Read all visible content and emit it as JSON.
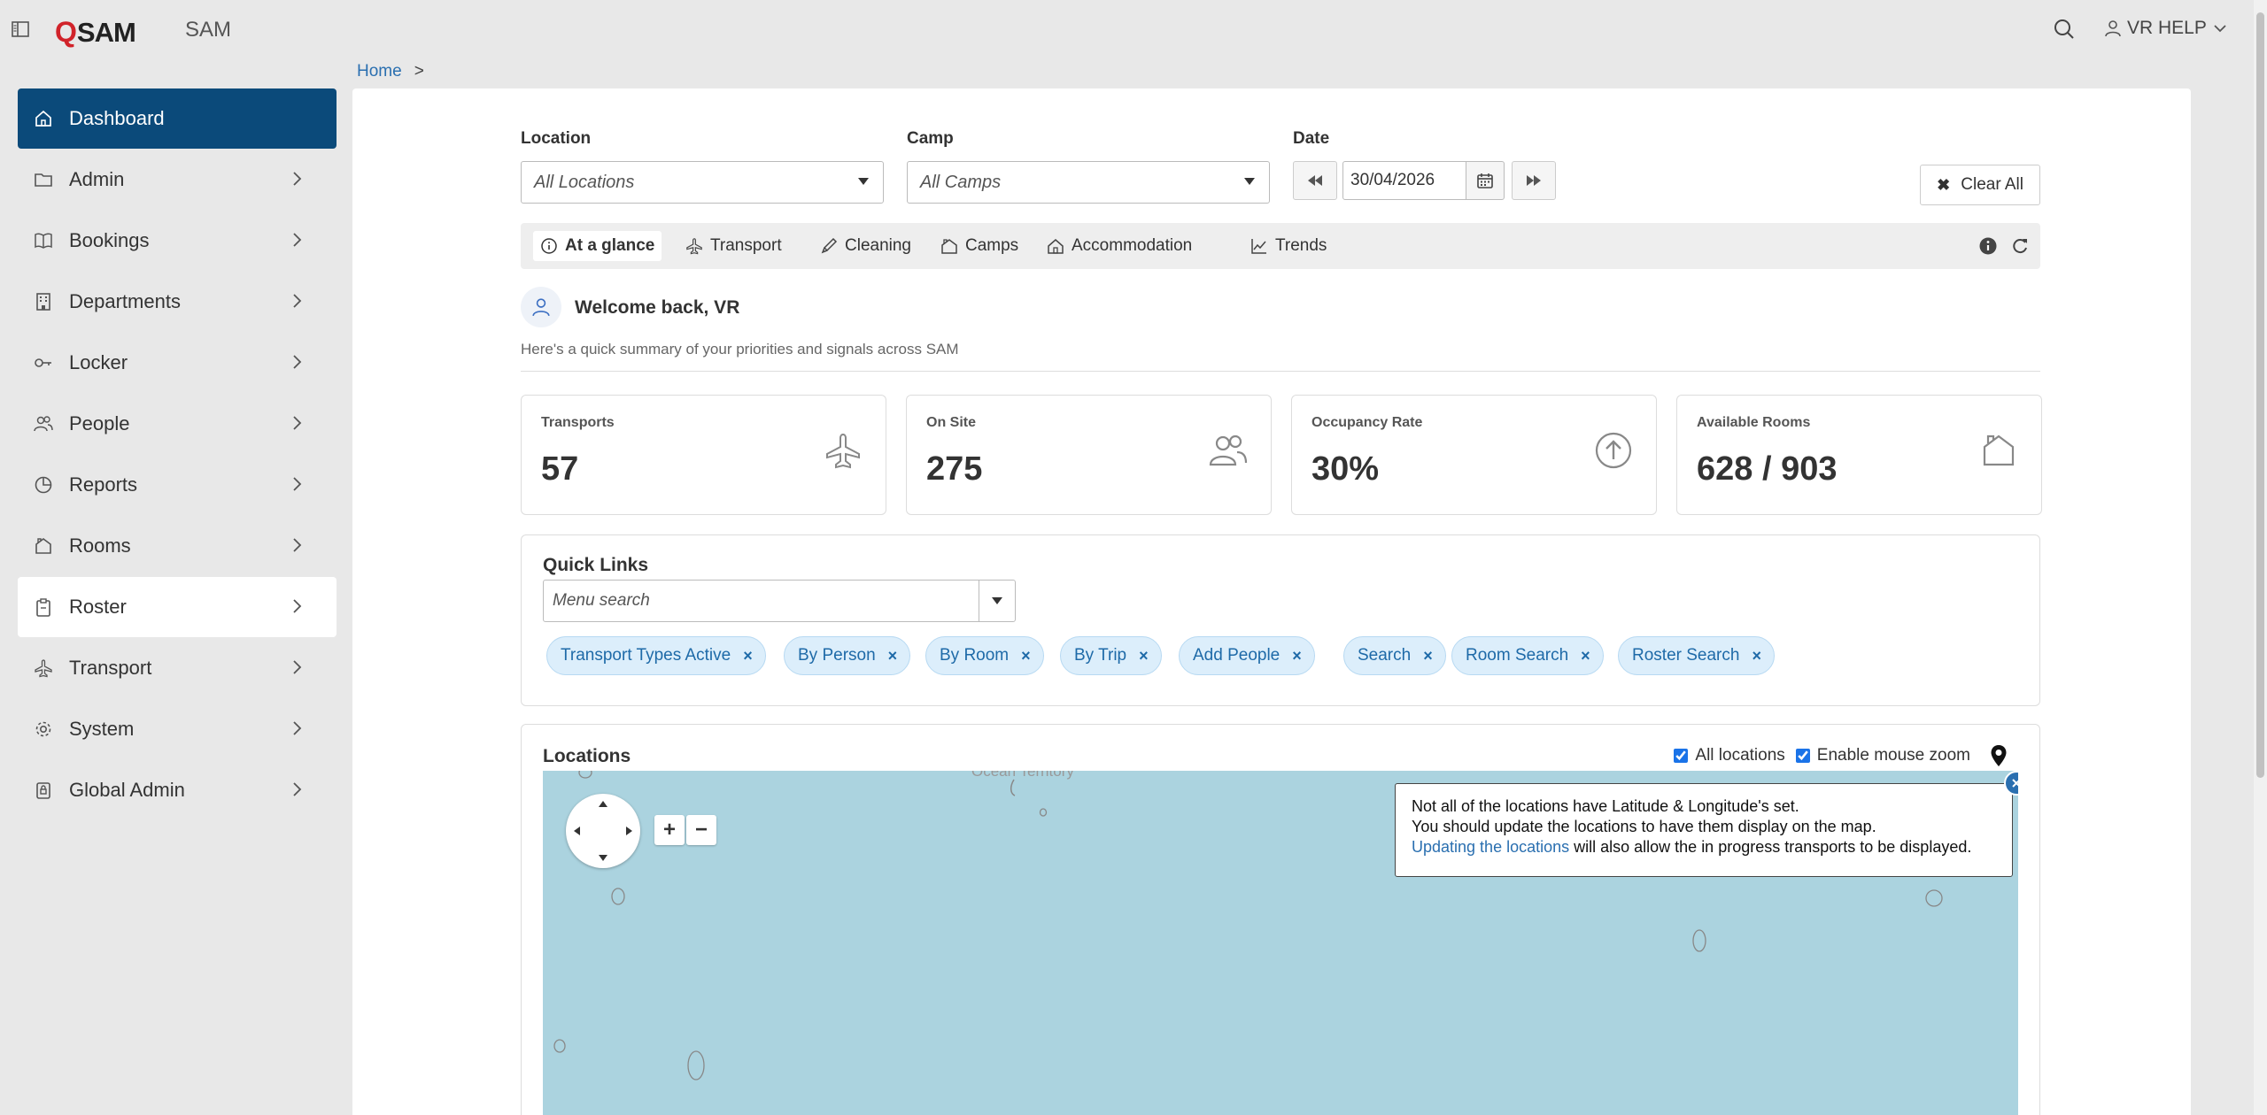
{
  "app": {
    "logo_text": "SAM",
    "logo_q": "Q",
    "name": "SAM"
  },
  "user": {
    "label": "VR HELP"
  },
  "breadcrumb": {
    "home": "Home",
    "sep": ">"
  },
  "sidebar": {
    "items": [
      {
        "label": "Dashboard",
        "icon": "home-icon"
      },
      {
        "label": "Admin",
        "icon": "folder-icon"
      },
      {
        "label": "Bookings",
        "icon": "book-icon"
      },
      {
        "label": "Departments",
        "icon": "building-icon"
      },
      {
        "label": "Locker",
        "icon": "key-icon"
      },
      {
        "label": "People",
        "icon": "people-icon"
      },
      {
        "label": "Reports",
        "icon": "pie-chart-icon"
      },
      {
        "label": "Rooms",
        "icon": "room-icon"
      },
      {
        "label": "Roster",
        "icon": "clipboard-icon"
      },
      {
        "label": "Transport",
        "icon": "plane-icon"
      },
      {
        "label": "System",
        "icon": "gear-icon"
      },
      {
        "label": "Global Admin",
        "icon": "lock-icon"
      }
    ]
  },
  "filters": {
    "location_label": "Location",
    "location_value": "All Locations",
    "camp_label": "Camp",
    "camp_value": "All Camps",
    "date_label": "Date",
    "date_value": "30/04/2026",
    "clear_all": "Clear All"
  },
  "tabs": [
    {
      "label": "At a glance",
      "icon": "info-icon"
    },
    {
      "label": "Transport",
      "icon": "plane-icon"
    },
    {
      "label": "Cleaning",
      "icon": "brush-icon"
    },
    {
      "label": "Camps",
      "icon": "camp-icon"
    },
    {
      "label": "Accommodation",
      "icon": "house-icon"
    },
    {
      "label": "Trends",
      "icon": "trend-icon"
    }
  ],
  "welcome": {
    "title": "Welcome back, VR",
    "subtitle": "Here's a quick summary of your priorities and signals across SAM"
  },
  "stats": [
    {
      "label": "Transports",
      "value": "57",
      "icon": "plane-icon"
    },
    {
      "label": "On Site",
      "value": "275",
      "icon": "people-icon"
    },
    {
      "label": "Occupancy Rate",
      "value": "30%",
      "icon": "arrow-up-circle-icon"
    },
    {
      "label": "Available Rooms",
      "value": "628 / 903",
      "icon": "room-icon"
    }
  ],
  "quick_links": {
    "title": "Quick Links",
    "search_placeholder": "Menu search",
    "chips": [
      "Transport Types Active",
      "By Person",
      "By Room",
      "By Trip",
      "Add People",
      "Search",
      "Room Search",
      "Roster Search"
    ]
  },
  "locations": {
    "title": "Locations",
    "all_locations": "All locations",
    "enable_zoom": "Enable mouse zoom",
    "map_label": "Ocean Territory",
    "notice_line1": "Not all of the locations have Latitude & Longitude's set.",
    "notice_line2": "You should update the locations to have them display on the map.",
    "notice_link": "Updating the locations",
    "notice_line3": " will also allow the in progress transports to be displayed."
  }
}
